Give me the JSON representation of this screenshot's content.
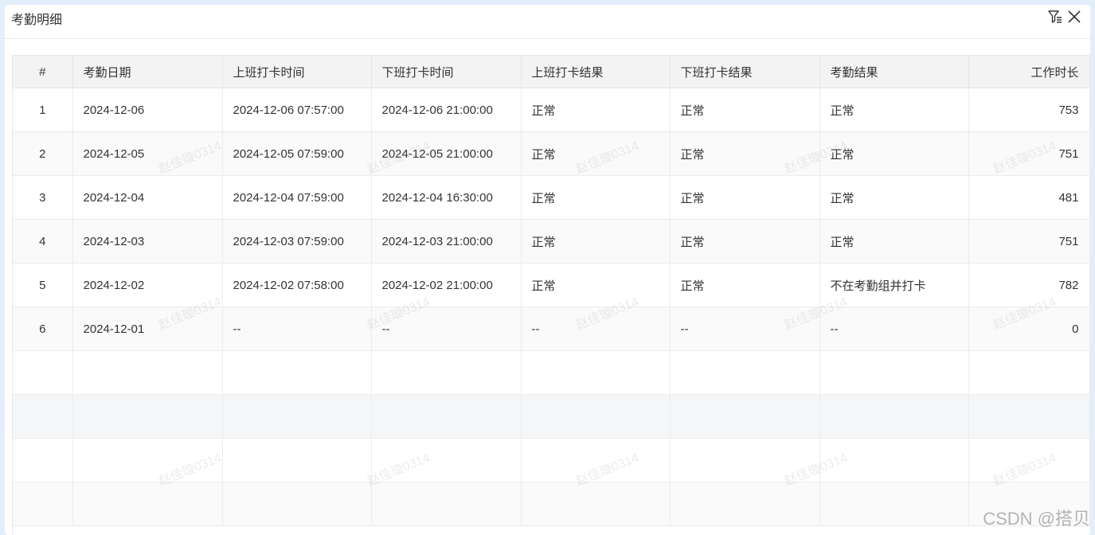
{
  "dialog": {
    "title": "考勤明细",
    "icons": [
      "filter-settings-icon",
      "close-icon"
    ]
  },
  "table": {
    "columns": [
      "#",
      "考勤日期",
      "上班打卡时间",
      "下班打卡时间",
      "上班打卡结果",
      "下班打卡结果",
      "考勤结果",
      "工作时长"
    ],
    "rows": [
      [
        "1",
        "2024-12-06",
        "2024-12-06 07:57:00",
        "2024-12-06 21:00:00",
        "正常",
        "正常",
        "正常",
        "753"
      ],
      [
        "2",
        "2024-12-05",
        "2024-12-05 07:59:00",
        "2024-12-05 21:00:00",
        "正常",
        "正常",
        "正常",
        "751"
      ],
      [
        "3",
        "2024-12-04",
        "2024-12-04 07:59:00",
        "2024-12-04 16:30:00",
        "正常",
        "正常",
        "正常",
        "481"
      ],
      [
        "4",
        "2024-12-03",
        "2024-12-03 07:59:00",
        "2024-12-03 21:00:00",
        "正常",
        "正常",
        "正常",
        "751"
      ],
      [
        "5",
        "2024-12-02",
        "2024-12-02 07:58:00",
        "2024-12-02 21:00:00",
        "正常",
        "正常",
        "不在考勤组并打卡",
        "782"
      ],
      [
        "6",
        "2024-12-01",
        "--",
        "--",
        "--",
        "--",
        "--",
        "0"
      ]
    ]
  },
  "watermark": "赵佳璇0314",
  "credit": "CSDN @搭贝"
}
